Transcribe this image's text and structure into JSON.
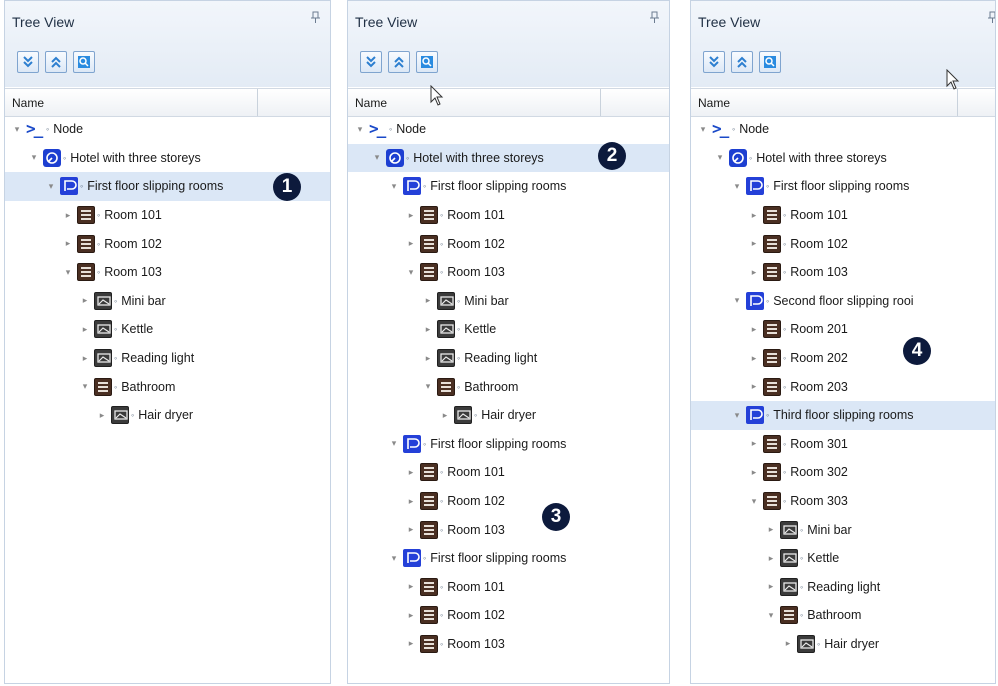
{
  "panel_title": "Tree View",
  "pin_glyph": "↕",
  "column_header": "Name",
  "toolbar_buttons": [
    {
      "name": "expand-all-icon",
      "tooltip": "Expand all"
    },
    {
      "name": "collapse-all-icon",
      "tooltip": "Collapse all"
    },
    {
      "name": "locate-icon",
      "tooltip": "Locate"
    }
  ],
  "colors": {
    "selected": "#dbe7f6",
    "badge": "#0d1a3c",
    "accent": "#1d3fd1"
  },
  "panels": [
    {
      "badge": "1",
      "rows": [
        {
          "indent": 0,
          "exp": "open",
          "icon": "node",
          "label": "Node"
        },
        {
          "indent": 1,
          "exp": "open",
          "icon": "hotel",
          "label": "Hotel with three storeys"
        },
        {
          "indent": 2,
          "exp": "open",
          "icon": "floor",
          "label": "First floor slipping rooms",
          "selected": true,
          "badge": true
        },
        {
          "indent": 3,
          "exp": "closed",
          "icon": "room",
          "label": "Room 101"
        },
        {
          "indent": 3,
          "exp": "closed",
          "icon": "room",
          "label": "Room 102"
        },
        {
          "indent": 3,
          "exp": "open",
          "icon": "room",
          "label": "Room 103"
        },
        {
          "indent": 4,
          "exp": "closed",
          "icon": "device",
          "label": "Mini bar"
        },
        {
          "indent": 4,
          "exp": "closed",
          "icon": "device",
          "label": "Kettle"
        },
        {
          "indent": 4,
          "exp": "closed",
          "icon": "device",
          "label": "Reading light"
        },
        {
          "indent": 4,
          "exp": "open",
          "icon": "room",
          "label": "Bathroom"
        },
        {
          "indent": 5,
          "exp": "closed",
          "icon": "device",
          "label": "Hair dryer"
        }
      ]
    },
    {
      "badge": "2",
      "rows": [
        {
          "indent": 0,
          "exp": "open",
          "icon": "node",
          "label": "Node"
        },
        {
          "indent": 1,
          "exp": "open",
          "icon": "hotel",
          "label": "Hotel with three storeys",
          "selected": true,
          "badge": true
        },
        {
          "indent": 2,
          "exp": "open",
          "icon": "floor",
          "label": "First floor slipping rooms"
        },
        {
          "indent": 3,
          "exp": "closed",
          "icon": "room",
          "label": "Room 101"
        },
        {
          "indent": 3,
          "exp": "closed",
          "icon": "room",
          "label": "Room 102"
        },
        {
          "indent": 3,
          "exp": "open",
          "icon": "room",
          "label": "Room 103"
        },
        {
          "indent": 4,
          "exp": "closed",
          "icon": "device",
          "label": "Mini bar"
        },
        {
          "indent": 4,
          "exp": "closed",
          "icon": "device",
          "label": "Kettle"
        },
        {
          "indent": 4,
          "exp": "closed",
          "icon": "device",
          "label": "Reading light"
        },
        {
          "indent": 4,
          "exp": "open",
          "icon": "room",
          "label": "Bathroom"
        },
        {
          "indent": 5,
          "exp": "closed",
          "icon": "device",
          "label": "Hair dryer"
        },
        {
          "indent": 2,
          "exp": "open",
          "icon": "floor",
          "label": "First floor slipping rooms"
        },
        {
          "indent": 3,
          "exp": "closed",
          "icon": "room",
          "label": "Room 101"
        },
        {
          "indent": 3,
          "exp": "closed",
          "icon": "room",
          "label": "Room 102"
        },
        {
          "indent": 3,
          "exp": "closed",
          "icon": "room",
          "label": "Room 103",
          "badge3": true
        },
        {
          "indent": 2,
          "exp": "open",
          "icon": "floor",
          "label": "First floor slipping rooms"
        },
        {
          "indent": 3,
          "exp": "closed",
          "icon": "room",
          "label": "Room 101"
        },
        {
          "indent": 3,
          "exp": "closed",
          "icon": "room",
          "label": "Room 102"
        },
        {
          "indent": 3,
          "exp": "closed",
          "icon": "room",
          "label": "Room 103"
        }
      ],
      "badge3": "3"
    },
    {
      "badge": "4",
      "rows": [
        {
          "indent": 0,
          "exp": "open",
          "icon": "node",
          "label": "Node"
        },
        {
          "indent": 1,
          "exp": "open",
          "icon": "hotel",
          "label": "Hotel with three storeys"
        },
        {
          "indent": 2,
          "exp": "open",
          "icon": "floor",
          "label": "First floor slipping rooms"
        },
        {
          "indent": 3,
          "exp": "closed",
          "icon": "room",
          "label": "Room 101"
        },
        {
          "indent": 3,
          "exp": "closed",
          "icon": "room",
          "label": "Room 102"
        },
        {
          "indent": 3,
          "exp": "closed",
          "icon": "room",
          "label": "Room 103"
        },
        {
          "indent": 2,
          "exp": "open",
          "icon": "floor",
          "label": "Second floor slipping rooi"
        },
        {
          "indent": 3,
          "exp": "closed",
          "icon": "room",
          "label": "Room 201"
        },
        {
          "indent": 3,
          "exp": "closed",
          "icon": "room",
          "label": "Room 202",
          "badge": true
        },
        {
          "indent": 3,
          "exp": "closed",
          "icon": "room",
          "label": "Room 203"
        },
        {
          "indent": 2,
          "exp": "open",
          "icon": "floor",
          "label": "Third floor slipping rooms",
          "selected": true
        },
        {
          "indent": 3,
          "exp": "closed",
          "icon": "room",
          "label": "Room 301"
        },
        {
          "indent": 3,
          "exp": "closed",
          "icon": "room",
          "label": "Room 302"
        },
        {
          "indent": 3,
          "exp": "open",
          "icon": "room",
          "label": "Room 303"
        },
        {
          "indent": 4,
          "exp": "closed",
          "icon": "device",
          "label": "Mini bar"
        },
        {
          "indent": 4,
          "exp": "closed",
          "icon": "device",
          "label": "Kettle"
        },
        {
          "indent": 4,
          "exp": "closed",
          "icon": "device",
          "label": "Reading light"
        },
        {
          "indent": 4,
          "exp": "open",
          "icon": "room",
          "label": "Bathroom"
        },
        {
          "indent": 5,
          "exp": "closed",
          "icon": "device",
          "label": "Hair dryer"
        }
      ]
    }
  ]
}
